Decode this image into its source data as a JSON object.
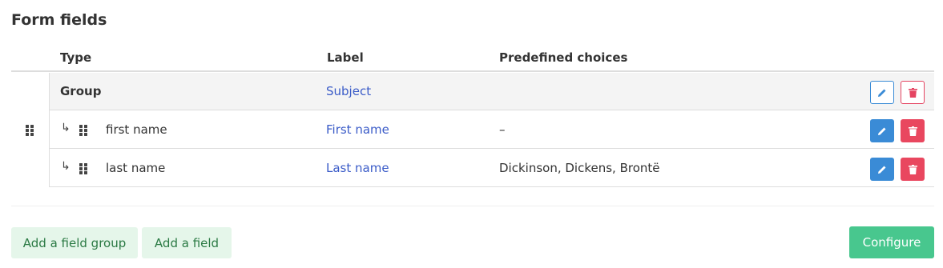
{
  "section": {
    "title": "Form fields"
  },
  "table": {
    "headers": {
      "type": "Type",
      "label": "Label",
      "choices": "Predefined choices"
    },
    "group_row": {
      "type": "Group",
      "label": "Subject",
      "choices": ""
    },
    "rows": [
      {
        "arrow": "↳",
        "type": "first name",
        "label": "First name",
        "choices": "–"
      },
      {
        "arrow": "↳",
        "type": "last name",
        "label": "Last name",
        "choices": "Dickinson, Dickens, Brontë"
      }
    ]
  },
  "actions": {
    "add_group": "Add a field group",
    "add_field": "Add a field",
    "configure": "Configure"
  },
  "icons": {
    "drag": "drag-handle-icon",
    "edit": "pencil-icon",
    "delete": "trash-icon",
    "child": "child-arrow-icon"
  },
  "colors": {
    "link": "#3b5cc8",
    "edit": "#3a8bd6",
    "delete": "#e9475f",
    "add_bg": "#e5f6ea",
    "add_text": "#2b7a44",
    "configure": "#48c78e"
  }
}
